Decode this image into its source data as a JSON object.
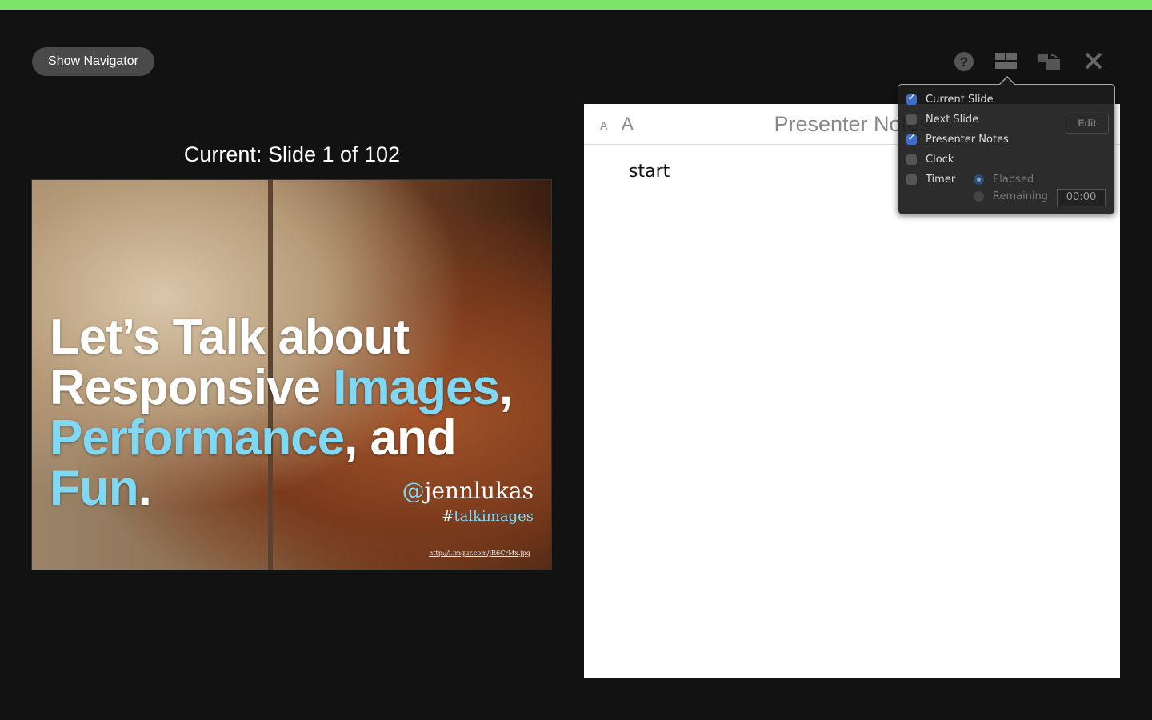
{
  "toolbar": {
    "show_navigator": "Show Navigator"
  },
  "current": {
    "label": "Current: Slide 1 of 102"
  },
  "slide": {
    "line1": "Let’s Talk about",
    "line2a": "Responsive ",
    "line2b": "Images",
    "line2c": ",",
    "line3a": "Performance",
    "line3b": ", and ",
    "line3c": "Fun",
    "line3d": ".",
    "handle_at": "@",
    "handle": "jennlukas",
    "hash_sym": "#",
    "hash": "talkimages",
    "url": "http://i.imgur.com/jR6CrMx.jpg"
  },
  "notes": {
    "font_small": "A",
    "font_big": "A",
    "title": "Presenter Notes",
    "edit": "Edit",
    "text": "start"
  },
  "popover": {
    "items": [
      {
        "label": "Current Slide",
        "checked": true
      },
      {
        "label": "Next Slide",
        "checked": false
      },
      {
        "label": "Presenter Notes",
        "checked": true
      },
      {
        "label": "Clock",
        "checked": false
      },
      {
        "label": "Timer",
        "checked": false
      }
    ],
    "elapsed": "Elapsed",
    "remaining": "Remaining",
    "time": "00:00"
  },
  "colors": {
    "accent": "#7ee36a",
    "slide_blue": "#7fd8f4"
  }
}
